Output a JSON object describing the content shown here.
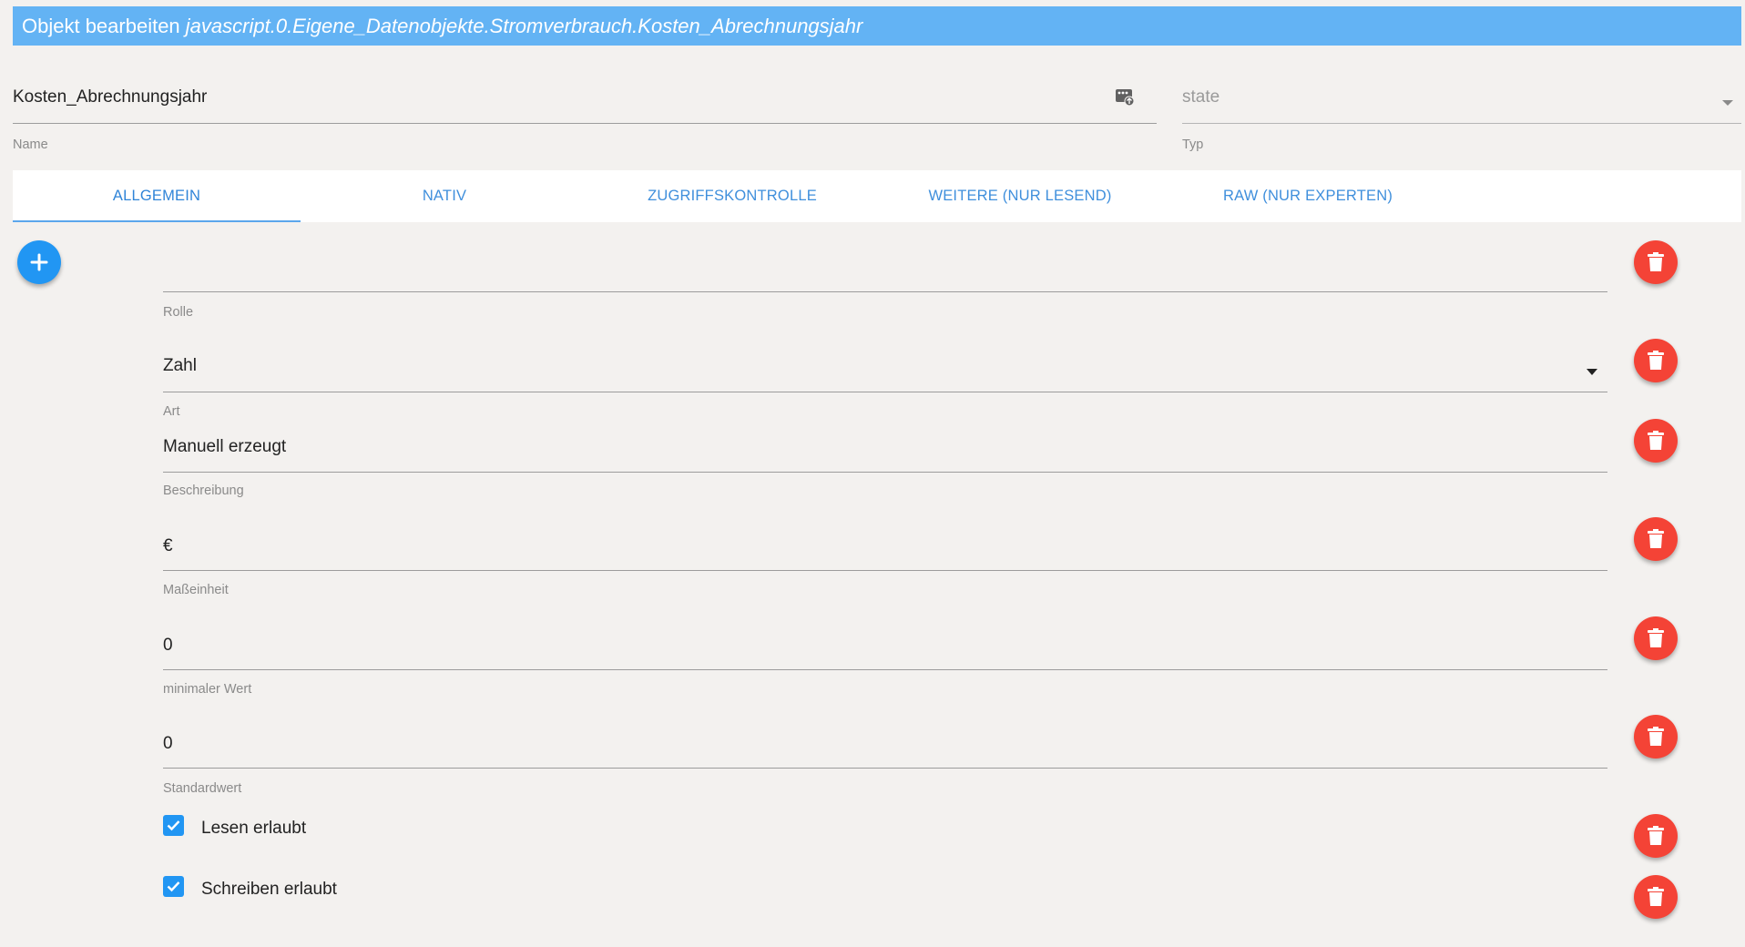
{
  "dialog": {
    "title_prefix": "Objekt bearbeiten",
    "object_id": "javascript.0.Eigene_Datenobjekte.Stromverbrauch.Kosten_Abrechnungsjahr"
  },
  "header_fields": {
    "name": {
      "value": "Kosten_Abrechnungsjahr",
      "label": "Name",
      "icon": "image-upload-icon"
    },
    "type": {
      "value": "state",
      "label": "Typ",
      "icon": "caret-down-icon"
    }
  },
  "tabs": [
    {
      "label": "ALLGEMEIN",
      "active": true
    },
    {
      "label": "NATIV",
      "active": false
    },
    {
      "label": "ZUGRIFFSKONTROLLE",
      "active": false
    },
    {
      "label": "WEITERE (NUR LESEND)",
      "active": false
    },
    {
      "label": "RAW (NUR EXPERTEN)",
      "active": false
    }
  ],
  "add_button": {
    "icon": "plus-icon"
  },
  "common_fields": {
    "role": {
      "label": "Rolle",
      "value": ""
    },
    "kind": {
      "label": "Art",
      "value": "Zahl",
      "icon": "caret-down-icon"
    },
    "description": {
      "label": "Beschreibung",
      "value": "Manuell erzeugt"
    },
    "unit": {
      "label": "Maßeinheit",
      "value": "€"
    },
    "min": {
      "label": "minimaler Wert",
      "value": "0"
    },
    "default": {
      "label": "Standardwert",
      "value": "0"
    }
  },
  "checkboxes": {
    "read": {
      "label": "Lesen erlaubt",
      "checked": true
    },
    "write": {
      "label": "Schreiben erlaubt",
      "checked": true
    }
  },
  "colors": {
    "title_bar": "#63b3f4",
    "accent_blue": "#2196f3",
    "delete_red": "#f44336",
    "background": "#f3f1ef"
  }
}
